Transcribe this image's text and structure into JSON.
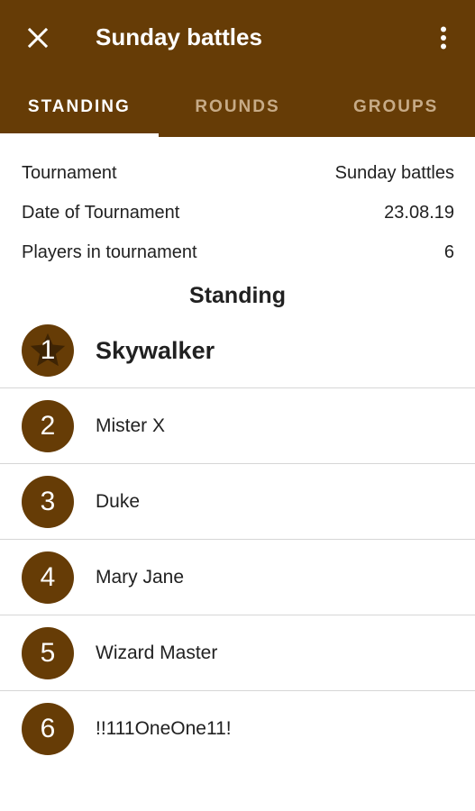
{
  "app_bar": {
    "title": "Sunday battles",
    "background_color": "#663c06",
    "close_icon": "close-icon",
    "menu_icon": "more-vert-icon"
  },
  "tabs": [
    {
      "label": "STANDING",
      "active": true
    },
    {
      "label": "ROUNDS",
      "active": false
    },
    {
      "label": "GROUPS",
      "active": false
    }
  ],
  "info": [
    {
      "label": "Tournament",
      "value": "Sunday battles"
    },
    {
      "label": "Date of Tournament",
      "value": "23.08.19"
    },
    {
      "label": "Players in tournament",
      "value": "6"
    }
  ],
  "standing": {
    "title": "Standing",
    "players": [
      {
        "rank": "1",
        "name": "Skywalker",
        "winner": true
      },
      {
        "rank": "2",
        "name": "Mister X",
        "winner": false
      },
      {
        "rank": "3",
        "name": "Duke",
        "winner": false
      },
      {
        "rank": "4",
        "name": "Mary Jane",
        "winner": false
      },
      {
        "rank": "5",
        "name": "Wizard Master",
        "winner": false
      },
      {
        "rank": "6",
        "name": "!!111OneOne11!",
        "winner": false
      }
    ]
  }
}
